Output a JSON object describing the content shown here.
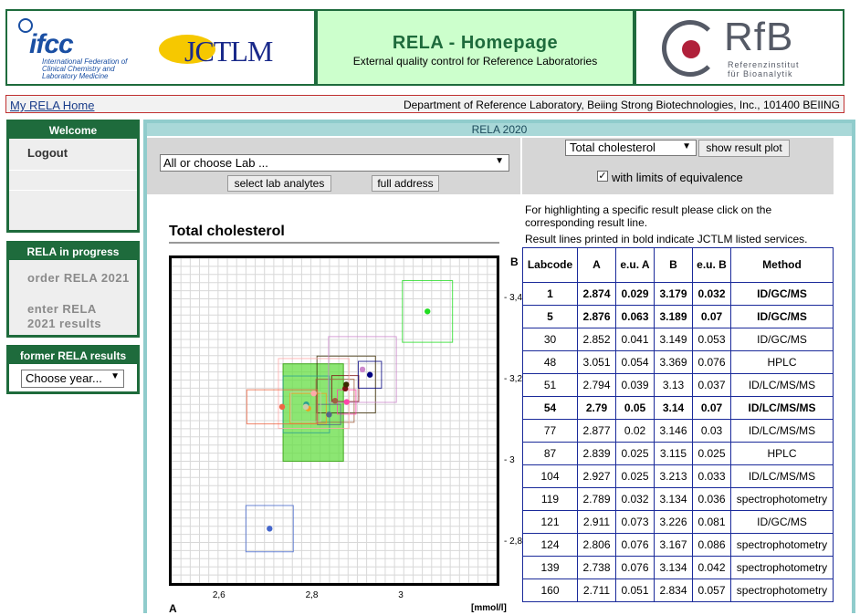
{
  "header": {
    "ifcc_logo": "ifcc",
    "ifcc_subtitle": "International Federation of Clinical Chemistry and Laboratory Medicine",
    "jctlm_logo": "JCTLM",
    "title": "RELA - Homepage",
    "subtitle": "External quality control for Reference Laboratories",
    "rfb_logo": "RfB",
    "rfb_subtitle_1": "Referenzinstitut",
    "rfb_subtitle_2": "für Bioanalytik"
  },
  "bar": {
    "home_link": "My RELA Home",
    "department": "Department of Reference Laboratory, Beiing Strong Biotechnologies, Inc., 101400 BEIING"
  },
  "sidebar": {
    "welcome_title": "Welcome",
    "logout": "Logout",
    "progress_title": "RELA in progress",
    "order": "order RELA 2021",
    "enter": "enter RELA 2021 results",
    "former_title": "former RELA results",
    "year_select": "Choose year..."
  },
  "main": {
    "title": "RELA 2020",
    "lab_select": "All or choose Lab ...",
    "select_analytes_button": "select lab analytes",
    "full_address_button": "full address",
    "analyte_select": "Total cholesterol",
    "show_plot_button": "show result plot",
    "equivalence_checkbox_label": "with limits of equivalence",
    "info_line_1": "For highlighting a specific result please click on the corresponding result line.",
    "info_line_2": "Result lines printed in bold indicate JCTLM listed services."
  },
  "colors": {
    "header_green": "#1e6b3c",
    "title_bg": "#ccffcc",
    "table_border": "#1a2a9a",
    "main_border": "#90cccc"
  },
  "table": {
    "headers": [
      "Labcode",
      "A",
      "e.u. A",
      "B",
      "e.u. B",
      "Method"
    ],
    "rows": [
      {
        "labcode": "1",
        "a": "2.874",
        "eua": "0.029",
        "b": "3.179",
        "eub": "0.032",
        "method": "ID/GC/MS",
        "bold": true
      },
      {
        "labcode": "5",
        "a": "2.876",
        "eua": "0.063",
        "b": "3.189",
        "eub": "0.07",
        "method": "ID/GC/MS",
        "bold": true
      },
      {
        "labcode": "30",
        "a": "2.852",
        "eua": "0.041",
        "b": "3.149",
        "eub": "0.053",
        "method": "ID/GC/MS",
        "bold": false
      },
      {
        "labcode": "48",
        "a": "3.051",
        "eua": "0.054",
        "b": "3.369",
        "eub": "0.076",
        "method": "HPLC",
        "bold": false
      },
      {
        "labcode": "51",
        "a": "2.794",
        "eua": "0.039",
        "b": "3.13",
        "eub": "0.037",
        "method": "ID/LC/MS/MS",
        "bold": false
      },
      {
        "labcode": "54",
        "a": "2.79",
        "eua": "0.05",
        "b": "3.14",
        "eub": "0.07",
        "method": "ID/LC/MS/MS",
        "bold": true
      },
      {
        "labcode": "77",
        "a": "2.877",
        "eua": "0.02",
        "b": "3.146",
        "eub": "0.03",
        "method": "ID/LC/MS/MS",
        "bold": false
      },
      {
        "labcode": "87",
        "a": "2.839",
        "eua": "0.025",
        "b": "3.115",
        "eub": "0.025",
        "method": "HPLC",
        "bold": false
      },
      {
        "labcode": "104",
        "a": "2.927",
        "eua": "0.025",
        "b": "3.213",
        "eub": "0.033",
        "method": "ID/LC/MS/MS",
        "bold": false
      },
      {
        "labcode": "119",
        "a": "2.789",
        "eua": "0.032",
        "b": "3.134",
        "eub": "0.036",
        "method": "spectrophotometry",
        "bold": false
      },
      {
        "labcode": "121",
        "a": "2.911",
        "eua": "0.073",
        "b": "3.226",
        "eub": "0.081",
        "method": "ID/GC/MS",
        "bold": false
      },
      {
        "labcode": "124",
        "a": "2.806",
        "eua": "0.076",
        "b": "3.167",
        "eub": "0.086",
        "method": "spectrophotometry",
        "bold": false
      },
      {
        "labcode": "139",
        "a": "2.738",
        "eua": "0.076",
        "b": "3.134",
        "eub": "0.042",
        "method": "spectrophotometry",
        "bold": false
      },
      {
        "labcode": "160",
        "a": "2.711",
        "eua": "0.051",
        "b": "2.834",
        "eub": "0.057",
        "method": "spectrophotometry",
        "bold": false
      }
    ]
  },
  "chart_data": {
    "type": "scatter",
    "title": "Total cholesterol",
    "xlabel": "A",
    "ylabel": "B",
    "unit": "[mmol/l]",
    "xlim": [
      2.5,
      3.2
    ],
    "ylim": [
      2.7,
      3.5
    ],
    "x_ticks": [
      2.6,
      2.8,
      3.0
    ],
    "x_tick_labels": [
      "2,6",
      "2,8",
      "3"
    ],
    "y_ticks": [
      2.8,
      3.0,
      3.2,
      3.4
    ],
    "y_tick_labels": [
      "2,8",
      "3",
      "3,2",
      "3,4"
    ],
    "grid": true,
    "points": [
      {
        "labcode": "1",
        "x": 2.874,
        "y": 3.179,
        "ex": 0.029,
        "ey": 0.032,
        "color": "#7a1010"
      },
      {
        "labcode": "5",
        "x": 2.876,
        "y": 3.189,
        "ex": 0.063,
        "ey": 0.07,
        "color": "#3a2a00"
      },
      {
        "labcode": "30",
        "x": 2.852,
        "y": 3.149,
        "ex": 0.041,
        "ey": 0.053,
        "color": "#a06040"
      },
      {
        "labcode": "48",
        "x": 3.051,
        "y": 3.369,
        "ex": 0.054,
        "ey": 0.076,
        "color": "#22dd22"
      },
      {
        "labcode": "51",
        "x": 2.794,
        "y": 3.13,
        "ex": 0.039,
        "ey": 0.037,
        "color": "#f0a020"
      },
      {
        "labcode": "54",
        "x": 2.79,
        "y": 3.14,
        "ex": 0.05,
        "ey": 0.07,
        "color": "#2aa090"
      },
      {
        "labcode": "77",
        "x": 2.877,
        "y": 3.146,
        "ex": 0.02,
        "ey": 0.03,
        "color": "#ff44aa"
      },
      {
        "labcode": "87",
        "x": 2.839,
        "y": 3.115,
        "ex": 0.025,
        "ey": 0.025,
        "color": "#556688"
      },
      {
        "labcode": "104",
        "x": 2.927,
        "y": 3.213,
        "ex": 0.025,
        "ey": 0.033,
        "color": "#000080"
      },
      {
        "labcode": "119",
        "x": 2.789,
        "y": 3.134,
        "ex": 0.032,
        "ey": 0.036,
        "color": "#ccccaa"
      },
      {
        "labcode": "121",
        "x": 2.911,
        "y": 3.226,
        "ex": 0.073,
        "ey": 0.081,
        "color": "#cc88cc"
      },
      {
        "labcode": "124",
        "x": 2.806,
        "y": 3.167,
        "ex": 0.076,
        "ey": 0.086,
        "color": "#ffaaaa"
      },
      {
        "labcode": "139",
        "x": 2.738,
        "y": 3.134,
        "ex": 0.076,
        "ey": 0.042,
        "color": "#ee6644"
      },
      {
        "labcode": "160",
        "x": 2.711,
        "y": 2.834,
        "ex": 0.051,
        "ey": 0.057,
        "color": "#4466cc"
      }
    ],
    "highlight_box": {
      "x": [
        2.74,
        2.87
      ],
      "y": [
        3.0,
        3.24
      ],
      "color": "#66dd44"
    }
  }
}
